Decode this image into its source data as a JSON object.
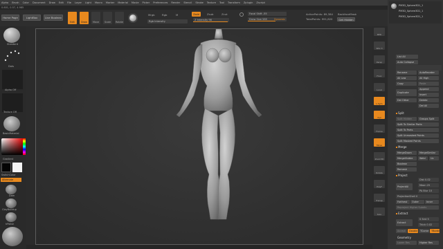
{
  "menu": [
    "Alpha",
    "Brush",
    "Color",
    "Document",
    "Draw",
    "Edit",
    "File",
    "Layer",
    "Light",
    "Macro",
    "Marker",
    "Material",
    "Movie",
    "Picker",
    "Preferences",
    "Render",
    "Stencil",
    "Stroke",
    "Texture",
    "Tool",
    "Transform",
    "Zplugin",
    "Zscript"
  ],
  "coords": "0.601, 0.57, 4.985",
  "toolbar": {
    "home_page": "Home Page",
    "lightbox": "LightBox",
    "live_boolean": "Live Boolean",
    "edit": "Edit",
    "draw": "Draw",
    "move": "Move",
    "scale": "Scale",
    "rotate": "Rotate",
    "mrgb": "Mrgb",
    "rgb": "Rgb",
    "m": "M",
    "rgb_intensity": "Rgb Intensity",
    "zadd": "Zadd",
    "zsub": "Zsub",
    "zcut": "Zcut",
    "z_intensity": "Z Intensity 98",
    "focal_shift": "Focal Shift -55",
    "draw_size": "Draw Size 585",
    "dynamic": "Dynamic",
    "active_points": "ActivePoints: 89,384",
    "total_points": "TotalPoints: 991,820",
    "backface": "BackfaceMask",
    "get_hidden": "Get Hidden"
  },
  "left": {
    "brush": "Standard",
    "stroke": "Dots",
    "alpha": "Alpha Off",
    "texture": "Texture Off",
    "material": "BasicMaterial",
    "gradient": "Gradient",
    "switch_color": "SwitchColor",
    "alternate": "Alternate",
    "b1": "Dam",
    "b2": "ClayBuildup",
    "b3": "hPolish"
  },
  "colors": {
    "accent": "#e8891e",
    "panel": "#333333",
    "canvas": "#2b2b2b"
  },
  "rightshelf": [
    "BPR",
    "SPix 3",
    "Persp",
    "Floor",
    "Local",
    "L.Sym",
    "Xyz",
    "Frame",
    "Move",
    "Zoom3D",
    "Rotate",
    "PolyF",
    "Transp",
    "Solo"
  ],
  "tool_thumbs": [
    "PM3D_Sphere3D1_1",
    "PM3D_Sphere3D1_1",
    "PM3D_Sphere3D1_1"
  ],
  "panel": {
    "list_all": "List All",
    "auto_collapse": "Auto Collapse",
    "subtool_buttons": [
      "Rename",
      "AutoReorder",
      "All Low",
      "All High",
      "Copy",
      "Paste",
      "Duplicate",
      "Append",
      "Insert",
      "Delete",
      "Del Other",
      "Del All"
    ],
    "split_head": "Split",
    "split": [
      "Split Hidden",
      "Groups Split",
      "Split To Similar Parts",
      "Split To Parts",
      "Split Unmasked Points",
      "Split Masked Points"
    ],
    "merge_head": "Merge",
    "merge": [
      "MergeDown",
      "MergeSimilar",
      "MergeVisible",
      "Weld",
      "Uv",
      "Boolean",
      "Remesh"
    ],
    "project_head": "Project",
    "project": {
      "projectall": "ProjectAll",
      "dist": "Dist 0.02",
      "mean": "Mean 25",
      "pa_blur": "PA Blur 10",
      "shell": "ProjectionShell 0",
      "farthest": "Farthest",
      "outer": "Outer",
      "inner": "Inner",
      "reproject": "Reproject Higher Subdiv"
    },
    "extract_head": "Extract",
    "extract": {
      "extract": "Extract",
      "smooth": "S Smt 5",
      "thick": "Thick 0.02",
      "accept": "Accept",
      "double": "Double",
      "tcorner": "TCorne",
      "tborder": "TBorde"
    },
    "geometry_head": "Geometry",
    "lower": "Lower Res",
    "higher": "Higher Res"
  }
}
